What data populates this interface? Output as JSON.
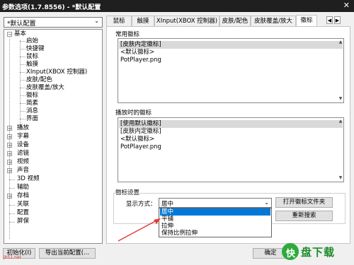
{
  "window": {
    "title": "参数选项(1.7.8556) - *默认配置",
    "close_glyph": "✕"
  },
  "profile_select": {
    "value": "*默认配置"
  },
  "tree": [
    {
      "label": "基本",
      "expanded": true
    },
    {
      "label": "启始"
    },
    {
      "label": "快捷键"
    },
    {
      "label": "鼠标"
    },
    {
      "label": "触摸"
    },
    {
      "label": "XInput(XBOX 控制器)"
    },
    {
      "label": "皮肤/配色"
    },
    {
      "label": "皮肤覆盖/放大"
    },
    {
      "label": "徽标"
    },
    {
      "label": "简素"
    },
    {
      "label": "消息"
    },
    {
      "label": "界面"
    },
    {
      "label": "播放",
      "collapsed": true
    },
    {
      "label": "字幕",
      "collapsed": true
    },
    {
      "label": "设备",
      "collapsed": true
    },
    {
      "label": "滤镜",
      "collapsed": true
    },
    {
      "label": "视频",
      "collapsed": true
    },
    {
      "label": "声音",
      "collapsed": true
    },
    {
      "label": "3D 视频"
    },
    {
      "label": "辅助"
    },
    {
      "label": "存档",
      "collapsed": true
    },
    {
      "label": "关联"
    },
    {
      "label": "配置"
    },
    {
      "label": "屏保"
    }
  ],
  "tabs": [
    "鼠标",
    "触摸",
    "XInput(XBOX 控制器)",
    "皮肤/配色",
    "皮肤覆盖/放大",
    "徽标"
  ],
  "tab_nav": {
    "prev": "◀",
    "next": "▶"
  },
  "common_logo": {
    "label": "常用徽标",
    "items": [
      "[皮肤内定徽标]",
      "<默认徽标>",
      "PotPlayer.png"
    ]
  },
  "playing_logo": {
    "label": "播放时的徽标",
    "items": [
      "[使用默认徽标]",
      "[皮肤内定徽标]",
      "<默认徽标>",
      "PotPlayer.png"
    ]
  },
  "logo_settings": {
    "label": "徽标设置",
    "display_label": "显示方式：",
    "display_value": "居中",
    "open_folder": "打开徽标文件夹",
    "refresh": "重新搜索",
    "options": [
      "居中",
      "平铺",
      "拉伸",
      "保持比例拉伸"
    ]
  },
  "footer": {
    "init": "初始化(I)",
    "export": "导出当前配置(..."
  },
  "bottom_right": {
    "ok_partial": "确定"
  },
  "watermark": {
    "badge": "快",
    "text": "盘下载",
    "url": "jb51.net"
  },
  "colors": {
    "titlebar": "#1f1f1f",
    "highlight": "#0078d7",
    "annotation": "#e53935",
    "brand": "#2eaa3d"
  }
}
